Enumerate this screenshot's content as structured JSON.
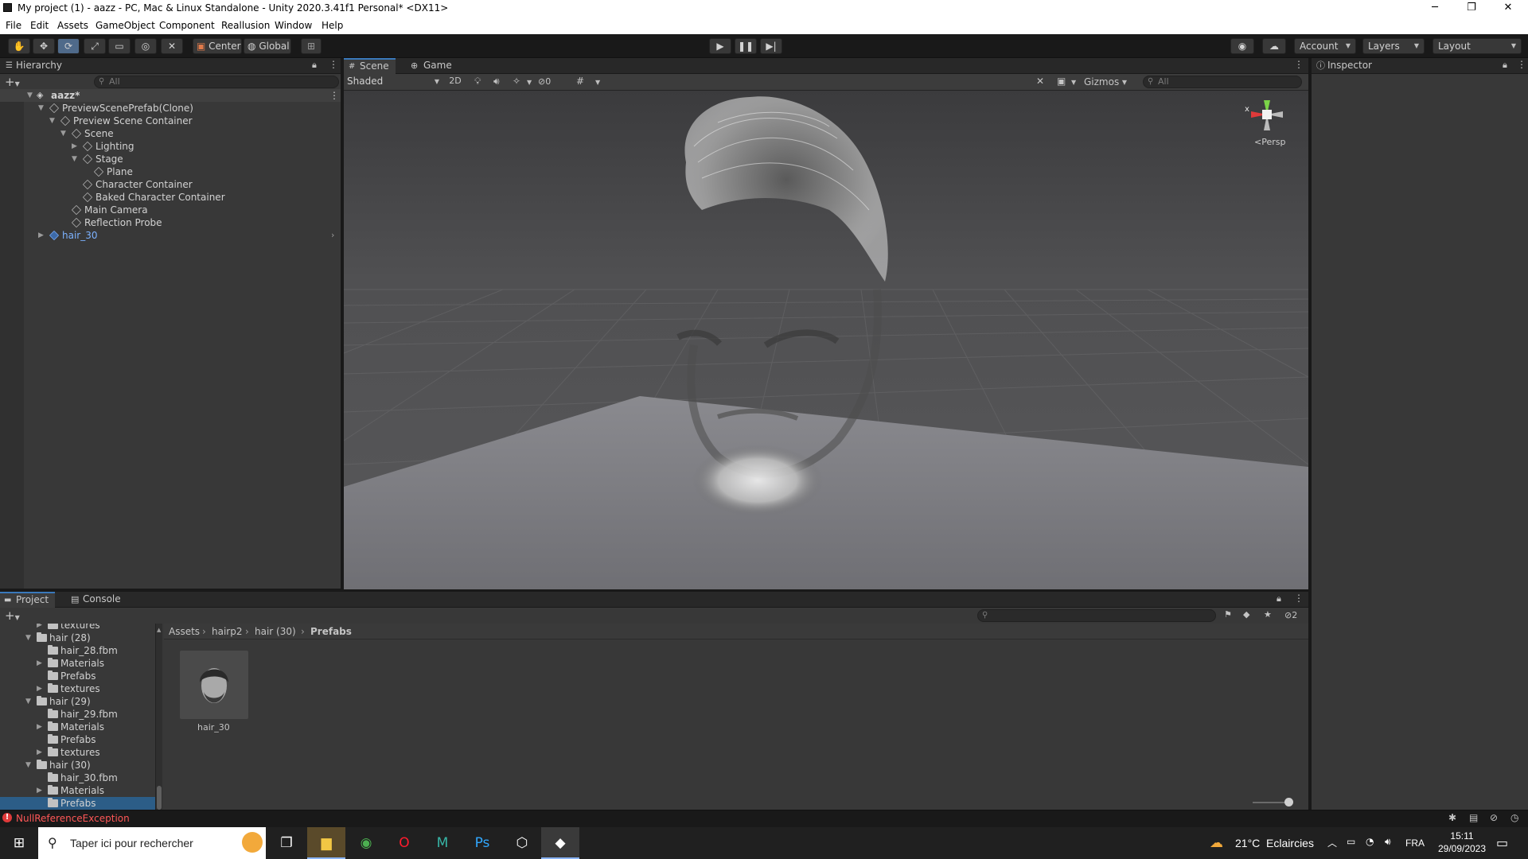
{
  "window": {
    "title": "My project (1) - aazz - PC, Mac & Linux Standalone - Unity 2020.3.41f1 Personal* <DX11>",
    "minimize": "─",
    "maximize": "❐",
    "close": "✕"
  },
  "menu": [
    "File",
    "Edit",
    "Assets",
    "GameObject",
    "Component",
    "Reallusion",
    "Window",
    "Help"
  ],
  "toolbar": {
    "pivot_label": "Center",
    "space_label": "Global",
    "account_label": "Account",
    "layers_label": "Layers",
    "layout_label": "Layout"
  },
  "hierarchy": {
    "tab_label": "Hierarchy",
    "search_placeholder": "All",
    "rows": [
      {
        "label": "aazz*"
      },
      {
        "label": "PreviewScenePrefab(Clone)"
      },
      {
        "label": "Preview Scene Container"
      },
      {
        "label": "Scene"
      },
      {
        "label": "Lighting"
      },
      {
        "label": "Stage"
      },
      {
        "label": "Plane"
      },
      {
        "label": "Character Container"
      },
      {
        "label": "Baked Character Container"
      },
      {
        "label": "Main Camera"
      },
      {
        "label": "Reflection Probe"
      },
      {
        "label": "hair_30"
      }
    ]
  },
  "scene": {
    "tabs": [
      "Scene",
      "Game"
    ],
    "shading_mode": "Shaded",
    "mode_2d": "2D",
    "hidden_count": "0",
    "gizmos_label": "Gizmos",
    "search_placeholder": "All",
    "gizmo": {
      "y_label": "y",
      "x_label": "x",
      "projection": "Persp"
    }
  },
  "inspector": {
    "tab_label": "Inspector"
  },
  "project": {
    "tabs": [
      "Project",
      "Console"
    ],
    "tree": [
      {
        "label": "textures"
      },
      {
        "label": "hair (28)"
      },
      {
        "label": "hair_28.fbm"
      },
      {
        "label": "Materials"
      },
      {
        "label": "Prefabs"
      },
      {
        "label": "textures"
      },
      {
        "label": "hair (29)"
      },
      {
        "label": "hair_29.fbm"
      },
      {
        "label": "Materials"
      },
      {
        "label": "Prefabs"
      },
      {
        "label": "textures"
      },
      {
        "label": "hair (30)"
      },
      {
        "label": "hair_30.fbm"
      },
      {
        "label": "Materials"
      },
      {
        "label": "Prefabs"
      }
    ],
    "breadcrumb": [
      "Assets",
      "hairp2",
      "hair (30)",
      "Prefabs"
    ],
    "asset": {
      "name": "hair_30"
    },
    "hidden_packages_count": "2"
  },
  "status": {
    "error": "NullReferenceException"
  },
  "taskbar": {
    "search_placeholder": "Taper ici pour rechercher",
    "weather": "21°C  Eclaircies",
    "language": "FRA",
    "time": "15:11",
    "date": "29/09/2023"
  },
  "colors": {
    "accent": "#3a79bb",
    "selection": "#2c5d87",
    "error": "#ff5757",
    "prefab_blue": "#7cb2ff"
  }
}
